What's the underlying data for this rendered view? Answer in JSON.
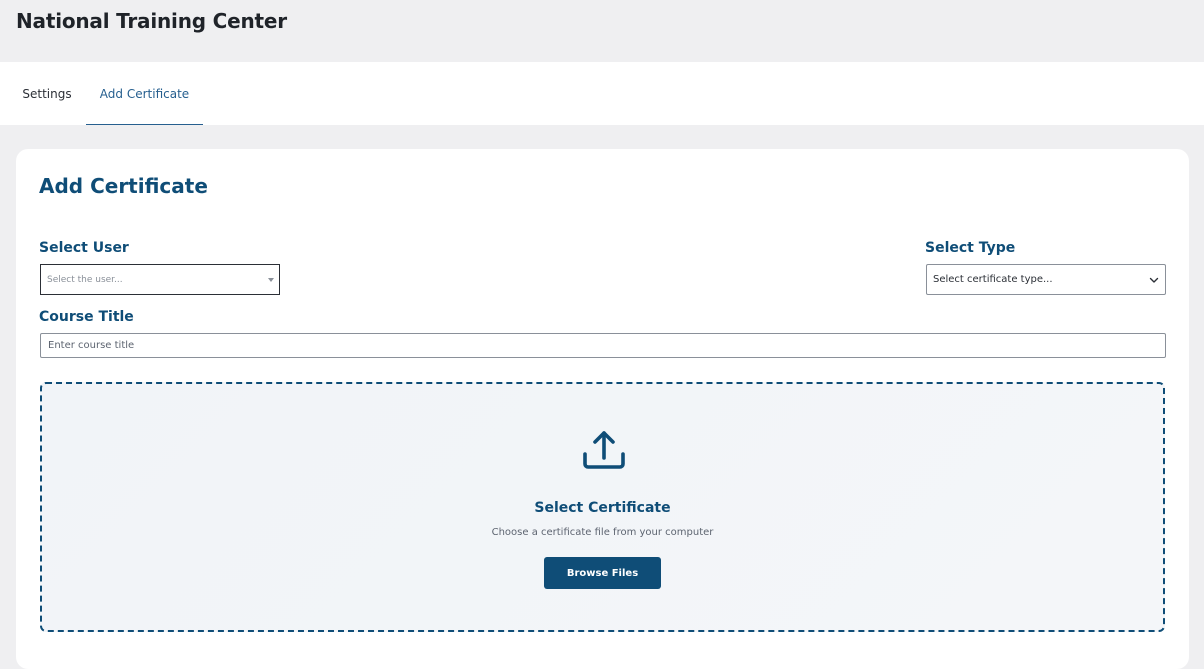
{
  "header": {
    "title": "National Training Center"
  },
  "tabs": [
    {
      "label": "Settings",
      "active": false
    },
    {
      "label": "Add Certificate",
      "active": true
    }
  ],
  "form": {
    "title": "Add Certificate",
    "select_user": {
      "label": "Select User",
      "placeholder": "Select the user..."
    },
    "select_type": {
      "label": "Select Type",
      "placeholder": "Select certificate type..."
    },
    "course_title": {
      "label": "Course Title",
      "placeholder": "Enter course title"
    }
  },
  "upload": {
    "title": "Select Certificate",
    "subtitle": "Choose a certificate file from your computer",
    "button_label": "Browse Files",
    "icon": "upload-icon"
  },
  "colors": {
    "accent": "#0f4d77",
    "tab_active": "#265f8f",
    "page_bg": "#efeff1"
  }
}
